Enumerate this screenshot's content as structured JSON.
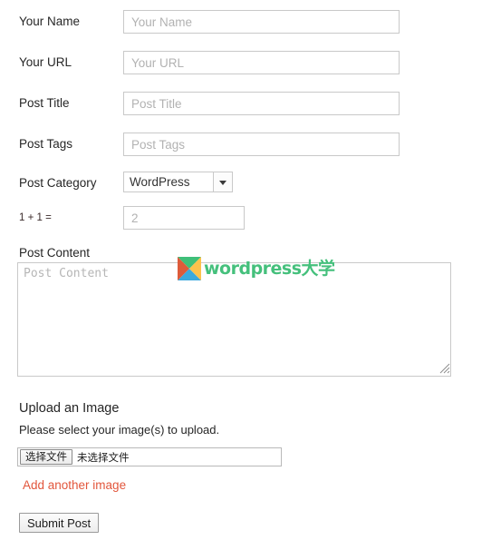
{
  "form": {
    "fields": [
      {
        "label": "Your Name",
        "placeholder": "Your Name",
        "value": ""
      },
      {
        "label": "Your URL",
        "placeholder": "Your URL",
        "value": ""
      },
      {
        "label": "Post Title",
        "placeholder": "Post Title",
        "value": ""
      },
      {
        "label": "Post Tags",
        "placeholder": "Post Tags",
        "value": ""
      }
    ],
    "category": {
      "label": "Post Category",
      "selected": "WordPress",
      "caret_icon": "chevron-down-icon"
    },
    "captcha": {
      "label": "1 + 1 =",
      "placeholder": "2",
      "value": ""
    },
    "content": {
      "label": "Post Content",
      "placeholder": "Post Content",
      "value": "",
      "resize_icon": "resize-handle-icon"
    }
  },
  "watermark": {
    "text": "wordpress大学",
    "mark_icon": "wordpress-daxue-logo-icon",
    "text_color": "#45c07c",
    "colors": {
      "top": "#3fbf79",
      "left": "#dd5b3a",
      "right": "#fcc24c",
      "bottom": "#3ba9de"
    }
  },
  "upload": {
    "title": "Upload an Image",
    "subtitle": "Please select your image(s) to upload.",
    "file_button_label": "选择文件",
    "file_status": "未选择文件",
    "add_another_label": "Add another image",
    "add_another_color": "#e2563c"
  },
  "actions": {
    "submit_label": "Submit Post"
  }
}
